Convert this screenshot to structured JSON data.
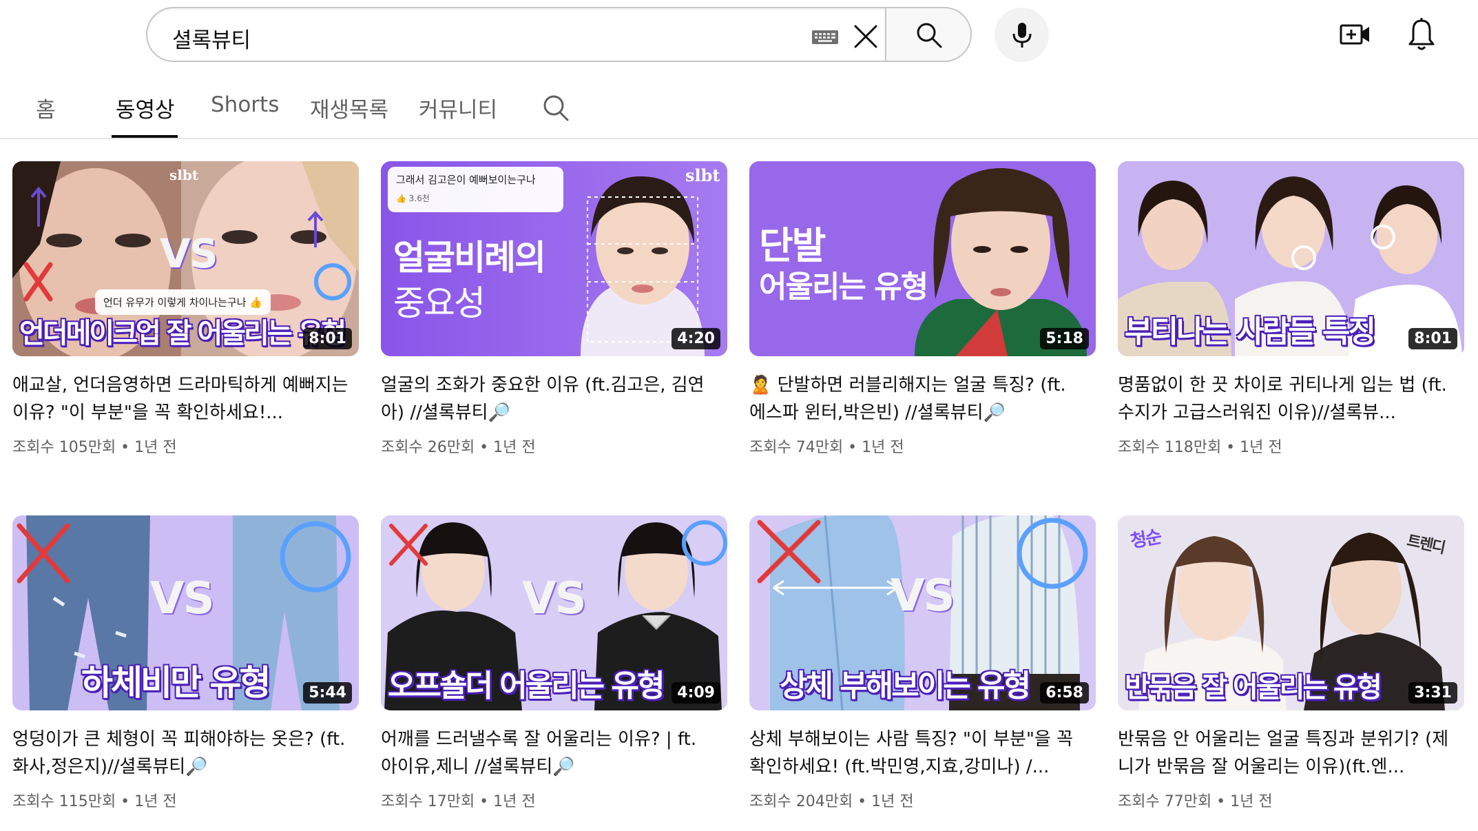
{
  "search": {
    "query": "셜록뷰티"
  },
  "tabs": [
    {
      "label": "홈"
    },
    {
      "label": "동영상"
    },
    {
      "label": "Shorts"
    },
    {
      "label": "재생목록"
    },
    {
      "label": "커뮤니티"
    }
  ],
  "active_tab": "동영상",
  "videos": [
    {
      "title": "애교살, 언더음영하면 드라마틱하게 예뻐지는 이유? \"이 부분\"을 꼭 확인하세요!...",
      "meta": "조회수 105만회 • 1년 전",
      "duration": "8:01",
      "banner": "언더메이크업 잘 어울리는 유형",
      "note": "언더 유무가 이렇게 차이나는구나 👍",
      "brand": "slbt",
      "vs": "VS"
    },
    {
      "title": "얼굴의 조화가 중요한 이유 (ft.김고은, 김연아) //셜록뷰티🔎",
      "meta": "조회수 26만회 • 1년 전",
      "duration": "4:20",
      "big1": "얼굴비례의",
      "big2": "중요성",
      "note": "그래서 김고은이 예뻐보이는구나",
      "note_sub": "👍 3.6천",
      "brand": "slbt"
    },
    {
      "title": "🙎 단발하면 러블리해지는 얼굴 특징? (ft. 에스파 윈터,박은빈) //셜록뷰티🔎",
      "meta": "조회수 74만회 • 1년 전",
      "duration": "5:18",
      "big1": "단발",
      "big2": "어울리는 유형"
    },
    {
      "title": "명품없이 한 끗 차이로 귀티나게 입는 법 (ft. 수지가 고급스러워진 이유)//셜록뷰...",
      "meta": "조회수 118만회 • 1년 전",
      "duration": "8:01",
      "banner": "부티나는 사람들 특징"
    },
    {
      "title": "엉덩이가 큰 체형이 꼭 피해야하는 옷은? (ft.화사,정은지)//셜록뷰티🔎",
      "meta": "조회수 115만회 • 1년 전",
      "duration": "5:44",
      "banner": "하체비만 유형",
      "vs": "VS"
    },
    {
      "title": "어깨를 드러낼수록 잘 어울리는 이유? | ft. 아이유,제니 //셜록뷰티🔎",
      "meta": "조회수 17만회 • 1년 전",
      "duration": "4:09",
      "banner": "오프숄더 어울리는 유형",
      "vs": "VS"
    },
    {
      "title": "상체 부해보이는 사람 특징? \"이 부분\"을 꼭 확인하세요! (ft.박민영,지효,강미나) /...",
      "meta": "조회수 204만회 • 1년 전",
      "duration": "6:58",
      "banner": "상체 부해보이는 유형",
      "vs": "VS"
    },
    {
      "title": "반묶음 안 어울리는 얼굴 특징과 분위기? (제니가 반묶음 잘 어울리는 이유)(ft.엔...",
      "meta": "조회수 77만회 • 1년 전",
      "duration": "3:31",
      "banner": "반묶음 잘 어울리는 유형",
      "tag1": "청순",
      "tag2": "트렌디"
    }
  ],
  "colors": {
    "accent_purple": "#7c4dff",
    "banner_outline": "#4b1fb8",
    "meta_gray": "#606060"
  }
}
